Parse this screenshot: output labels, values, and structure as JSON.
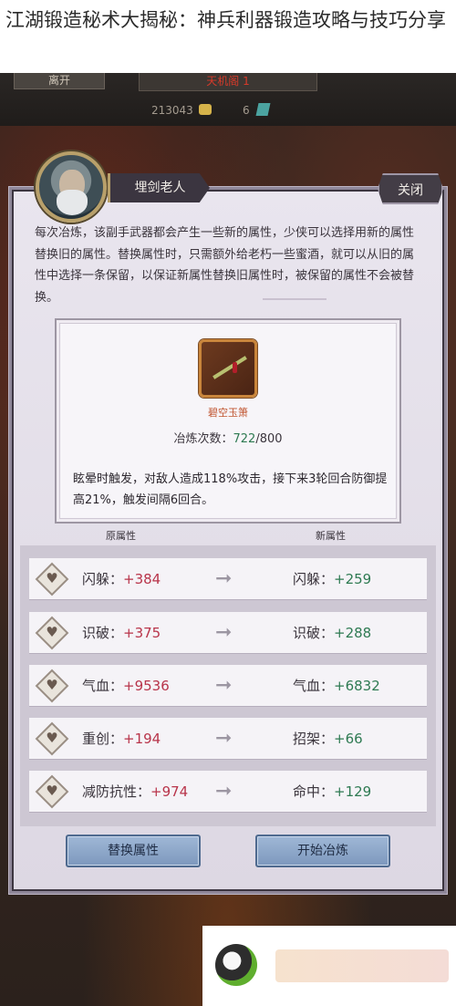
{
  "article": {
    "title": "江湖锻造秘术大揭秘：神兵利器锻造攻略与技巧分享"
  },
  "top_bar": {
    "tab_left": "离开",
    "tab_right": "天机阁 1",
    "gold": "213043",
    "gems": "6"
  },
  "npc": {
    "name": "埋剑老人",
    "close_label": "关闭"
  },
  "description": "每次冶炼，该副手武器都会产生一些新的属性，少侠可以选择用新的属性替换旧的属性。替换属性时，只需额外给老朽一些蜜酒，就可以从旧的属性中选择一条保留，以保证新属性替换旧属性时，被保留的属性不会被替换。",
  "weapon": {
    "name": "碧空玉箫",
    "refine_label": "冶炼次数：",
    "refine_current": "722",
    "refine_max": "/800",
    "effect": "眩晕时触发，对敌人造成118%攻击，接下来3轮回合防御提高21%，触发间隔6回合。"
  },
  "columns": {
    "old": "原属性",
    "new": "新属性"
  },
  "attributes": [
    {
      "old_name": "闪躲：",
      "old_value": "+384",
      "new_name": "闪躲：",
      "new_value": "+259"
    },
    {
      "old_name": "识破：",
      "old_value": "+375",
      "new_name": "识破：",
      "new_value": "+288"
    },
    {
      "old_name": "气血：",
      "old_value": "+9536",
      "new_name": "气血：",
      "new_value": "+6832"
    },
    {
      "old_name": "重创：",
      "old_value": "+194",
      "new_name": "招架：",
      "new_value": "+66"
    },
    {
      "old_name": "减防抗性：",
      "old_value": "+974",
      "new_name": "命中：",
      "new_value": "+129"
    }
  ],
  "buttons": {
    "replace": "替换属性",
    "refine": "开始冶炼"
  },
  "colors": {
    "old_value": "#b8344a",
    "new_value": "#2e7a52",
    "weapon_name": "#c0542e",
    "button": "#8ea8ca"
  },
  "icons": {
    "attribute_bullet": "heart-diamond-icon",
    "arrow": "right-arrow-icon"
  }
}
